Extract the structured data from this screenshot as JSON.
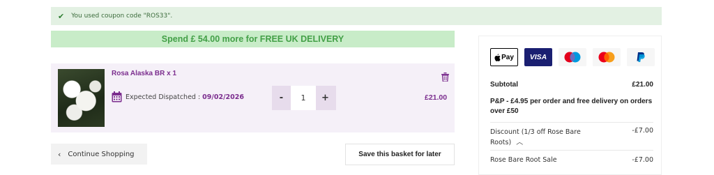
{
  "notice": {
    "text": "You used coupon code \"ROS33\"."
  },
  "delivery_banner": {
    "text": "Spend £ 54.00 more for FREE UK DELIVERY"
  },
  "cart_item": {
    "name": "Rosa Alaska BR x 1",
    "dispatch_label": "Expected Dispatched :",
    "dispatch_date": "09/02/2026",
    "quantity": "1",
    "minus_label": "-",
    "plus_label": "+",
    "price": "£21.00"
  },
  "actions": {
    "continue_label": "Continue Shopping",
    "save_label": "Save this basket for later"
  },
  "summary": {
    "payment_methods": [
      "Apple Pay",
      "VISA",
      "Maestro",
      "Mastercard",
      "PayPal"
    ],
    "apple_pay_label": "Pay",
    "visa_label": "VISA",
    "subtotal_label": "Subtotal",
    "subtotal_value": "£21.00",
    "pp_text": "P&P - £4.95 per order and free delivery on orders over £50",
    "discount_label": "Discount (1/3 off Rose Bare Roots)",
    "discount_value": "-£7.00",
    "sale_label": "Rose Bare Root Sale",
    "sale_value": "-£7.00"
  },
  "colors": {
    "brand_purple": "#7b2d8e",
    "delivery_green": "#43a047",
    "notice_bg": "#e3f1e3"
  }
}
